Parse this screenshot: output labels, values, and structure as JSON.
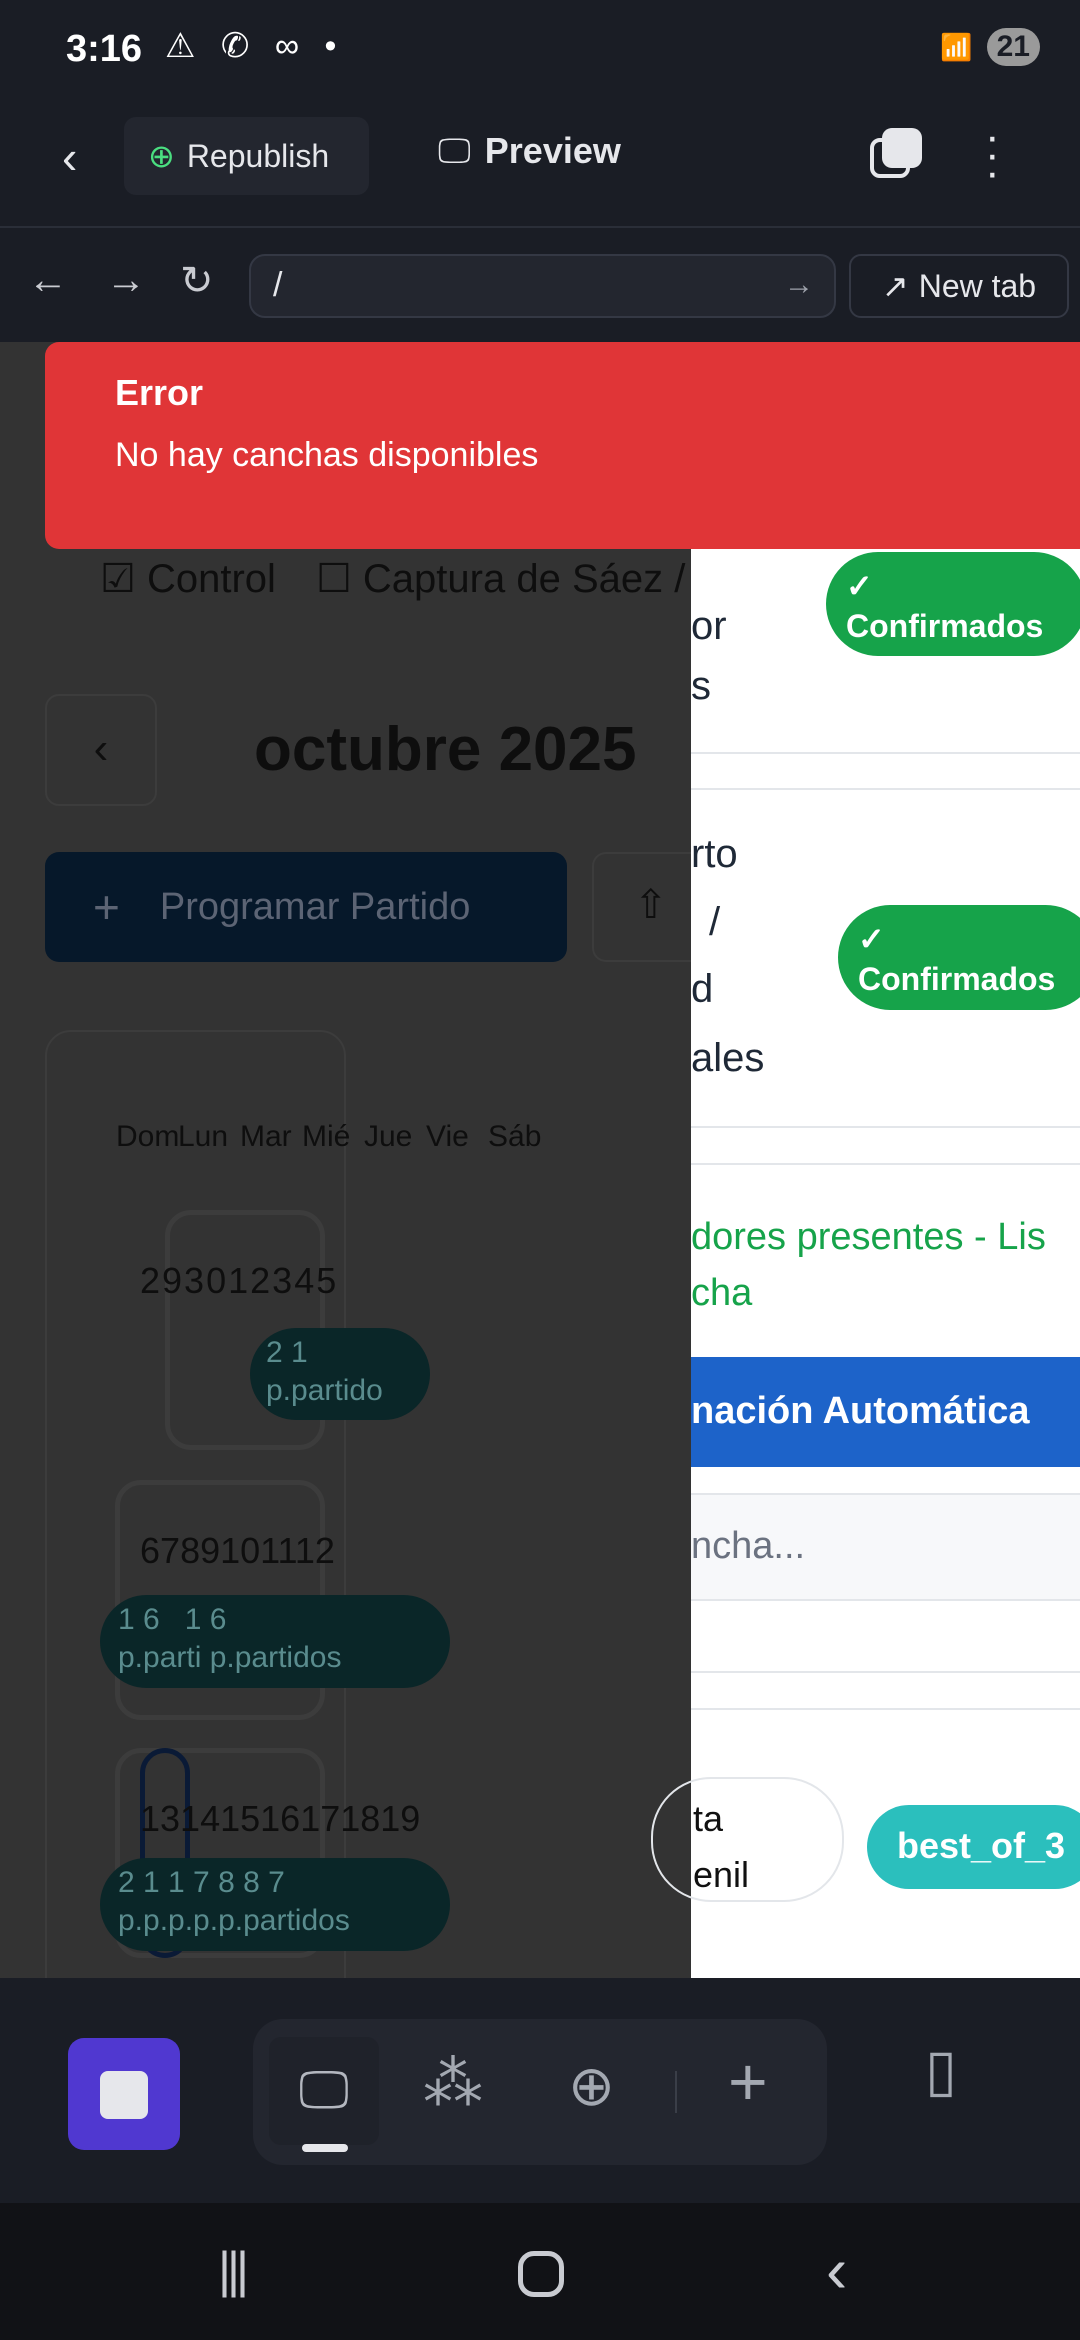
{
  "status_bar": {
    "time": "3:16",
    "battery": "21"
  },
  "header": {
    "republish_label": "Republish",
    "preview_label": "Preview"
  },
  "browser": {
    "url": "/",
    "new_tab_label": "New tab"
  },
  "toast": {
    "title": "Error",
    "message": "No hay canchas disponibles"
  },
  "left_page": {
    "filters": [
      "Control",
      "Captura de Sáez /"
    ],
    "month_title": "octubre 2025",
    "program_button": "Programar Partido",
    "weekdays": [
      "Dom",
      "Lun",
      "Mar",
      "Mié",
      "Jue",
      "Vie",
      "Sáb"
    ],
    "weeks": [
      {
        "days": [
          "29",
          "30",
          "1",
          "2",
          "3",
          "4",
          "5"
        ],
        "badge_counts": "2 1",
        "badge_label": "p.partido"
      },
      {
        "days": [
          "6",
          "7",
          "8",
          "9",
          "10",
          "11",
          "12"
        ],
        "badge_counts": "1 6   1 6",
        "badge_label": "p.parti p.partidos"
      },
      {
        "days": [
          "13",
          "14",
          "15",
          "16",
          "17",
          "18",
          "19"
        ],
        "badge_counts": "2 1 1 7 8 8 7",
        "badge_label": "p.p.p.p.p.partidos"
      }
    ]
  },
  "right_panel": {
    "row1_lines": [
      "or",
      "s"
    ],
    "confirmed_label": "✓ Confirmados",
    "row2_lines": [
      "rto",
      "/",
      "d",
      "ales"
    ],
    "players_text_1": "dores presentes - Lis",
    "players_text_2": "cha",
    "auto_assign_label": "nación Automática",
    "court_placeholder": "ncha...",
    "category_pill_1": "ta",
    "category_pill_2": "enil",
    "format_pill": "best_of_3"
  },
  "colors": {
    "error": "#e03537",
    "confirmed": "#16a34a",
    "format": "#2bbfbd",
    "primary": "#1d63c9",
    "accent": "#5038d0"
  }
}
